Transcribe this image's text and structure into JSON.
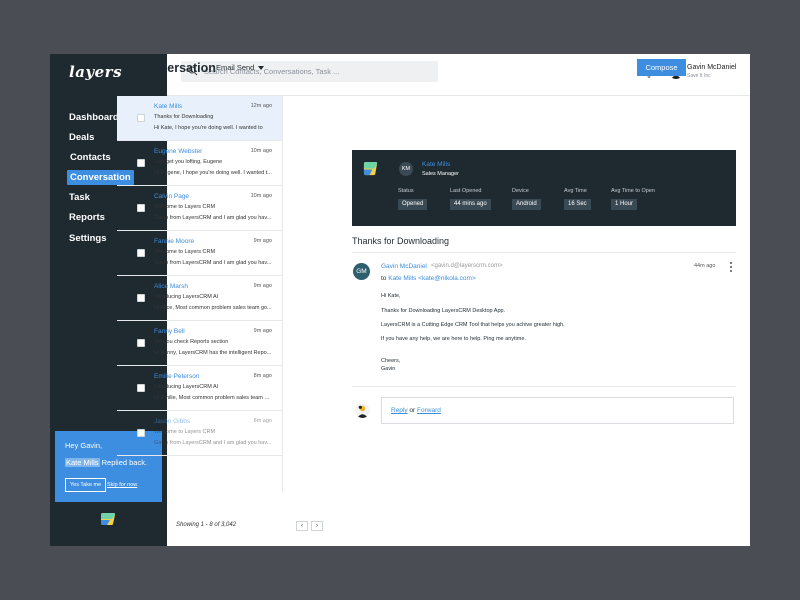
{
  "app": {
    "logo_text": "layers"
  },
  "sidebar": {
    "items": [
      {
        "label": "Dashboard"
      },
      {
        "label": "Deals"
      },
      {
        "label": "Contacts"
      },
      {
        "label": "Conversation",
        "active": true
      },
      {
        "label": "Task"
      },
      {
        "label": "Reports"
      },
      {
        "label": "Settings"
      }
    ]
  },
  "notification": {
    "greeting": "Hey Gavin,",
    "contact": "Kate Mills",
    "message": "Replied back.",
    "primary_action": "Yes Take me",
    "secondary_action": "Skip for now"
  },
  "topbar": {
    "search_placeholder": "Search Contacts, Conversations, Task ...",
    "user_name": "Gavin McDaniel",
    "user_org": "Save It Inc"
  },
  "header": {
    "title": "Conversation",
    "filter": "Email Send",
    "compose_label": "Compose"
  },
  "conversations": [
    {
      "name": "Kate Mills",
      "time": "12m ago",
      "subject": "Thanks for Downloading",
      "preview": "Hi Kate, I hope you're doing well. I wanted to",
      "selected": true
    },
    {
      "name": "Eugene Webster",
      "time": "10m ago",
      "subject": "Lets get you lofting, Eugene",
      "preview": "Hi Eugene, I hope you're doing well. I wanted t..."
    },
    {
      "name": "Calvin Page",
      "time": "10m ago",
      "subject": "Welcome to Layers CRM",
      "preview": "Gavin from LayersCRM and I am glad you hav..."
    },
    {
      "name": "Fannie Moore",
      "time": "9m ago",
      "subject": "Welcome to Layers CRM",
      "preview": "Gavin from LayersCRM and I am glad you hav..."
    },
    {
      "name": "Alice Marsh",
      "time": "9m ago",
      "subject": "Introducing LayersCRM AI",
      "preview": "Hi Alice, Most common problem sales team go..."
    },
    {
      "name": "Fanny Bell",
      "time": "9m ago",
      "subject": "Did you check Reports section",
      "preview": "Hi Fanny, LayersCRM has the intelligent Repo..."
    },
    {
      "name": "Emilie Peterson",
      "time": "8m ago",
      "subject": "Introducing LayersCRM AI",
      "preview": "Hi Emilie, Most common problem sales team go..."
    },
    {
      "name": "Jason Gibbs",
      "time": "8m ago",
      "subject": "Welcome to Layers CRM",
      "preview": "Gavin from LayersCRM and I am glad you hav...",
      "faded": true
    }
  ],
  "pagination": {
    "text": "Showing 1 - 8 of 3,042",
    "prev": "‹",
    "next": "›"
  },
  "contact_card": {
    "initials": "KM",
    "name": "Kate Mills",
    "role": "Sales Manager",
    "stats": [
      {
        "label": "Status",
        "value": "Opened"
      },
      {
        "label": "Last Opened",
        "value": "44 mins ago"
      },
      {
        "label": "Device",
        "value": "Android"
      },
      {
        "label": "Avg Time",
        "value": "16 Sec"
      },
      {
        "label": "Avg Time to Open",
        "value": "1 Hour"
      }
    ]
  },
  "email": {
    "subject": "Thanks for Downloading",
    "sender_initials": "GM",
    "from_name": "Gavin McDaniel",
    "from_address": "<gavin.d@layerscrm.com>",
    "to_prefix": "to",
    "to_name": "Kate Mills <kate@nikola.com>",
    "time": "44m ago",
    "body": [
      "Hi Kate,",
      "Thanks for Downloading LayersCRM Desktop App.",
      "LayersCRM is a Cutting Edge CRM Tool that helps you achive greater high.",
      "If you have any help, we are here to help. Ping me anytime.",
      "Cheers,",
      "Gavin"
    ]
  },
  "reply": {
    "reply_label": "Reply",
    "or_text": " or ",
    "forward_label": "Forward"
  },
  "colors": {
    "accent": "#3d8ee0",
    "sidebar_bg": "#1f2a30",
    "page_bg": "#4a4e54"
  }
}
